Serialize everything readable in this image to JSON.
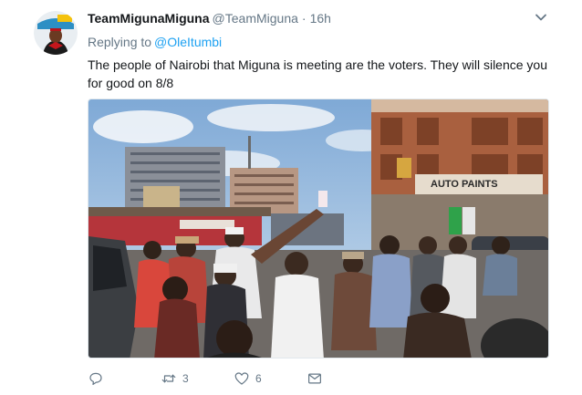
{
  "tweet": {
    "display_name": "TeamMigunaMiguna",
    "handle": "@TeamMiguna",
    "separator": "·",
    "time": "16h",
    "replying_prefix": "Replying to",
    "replying_to": "@OleItumbi",
    "text": "The people of Nairobi that Miguna is meeting are the voters. They will silence you for good on 8/8",
    "media": {
      "signs": {
        "auto_paints": "AUTO PAINTS"
      }
    },
    "actions": {
      "reply": {
        "icon": "reply-icon",
        "count": ""
      },
      "retweet": {
        "icon": "retweet-icon",
        "count": "3"
      },
      "like": {
        "icon": "heart-icon",
        "count": "6"
      },
      "message": {
        "icon": "envelope-icon",
        "count": ""
      }
    },
    "colors": {
      "link": "#1da1f2",
      "secondary": "#657786",
      "text": "#14171a"
    }
  }
}
